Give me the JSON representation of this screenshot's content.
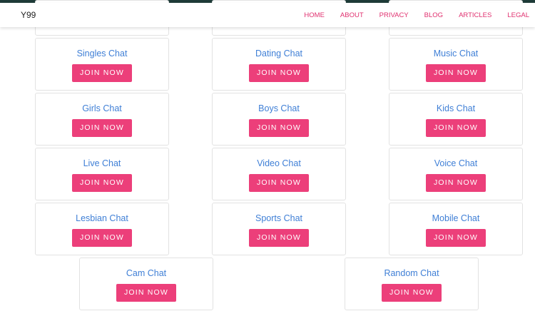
{
  "navbar": {
    "brand": "Y99",
    "links": [
      "HOME",
      "ABOUT",
      "PRIVACY",
      "BLOG",
      "ARTICLES",
      "LEGAL"
    ]
  },
  "button_label": "JOIN NOW",
  "colors": {
    "accent": "#ec3f7a",
    "title_blue": "#3f7fd6",
    "nav_pink": "#e0306f"
  },
  "rows": [
    [
      "Singles Chat",
      "Dating Chat",
      "Music Chat"
    ],
    [
      "Girls Chat",
      "Boys Chat",
      "Kids Chat"
    ],
    [
      "Live Chat",
      "Video Chat",
      "Voice Chat"
    ],
    [
      "Lesbian Chat",
      "Sports Chat",
      "Mobile Chat"
    ]
  ],
  "last_row": [
    "Cam Chat",
    "Random Chat"
  ]
}
